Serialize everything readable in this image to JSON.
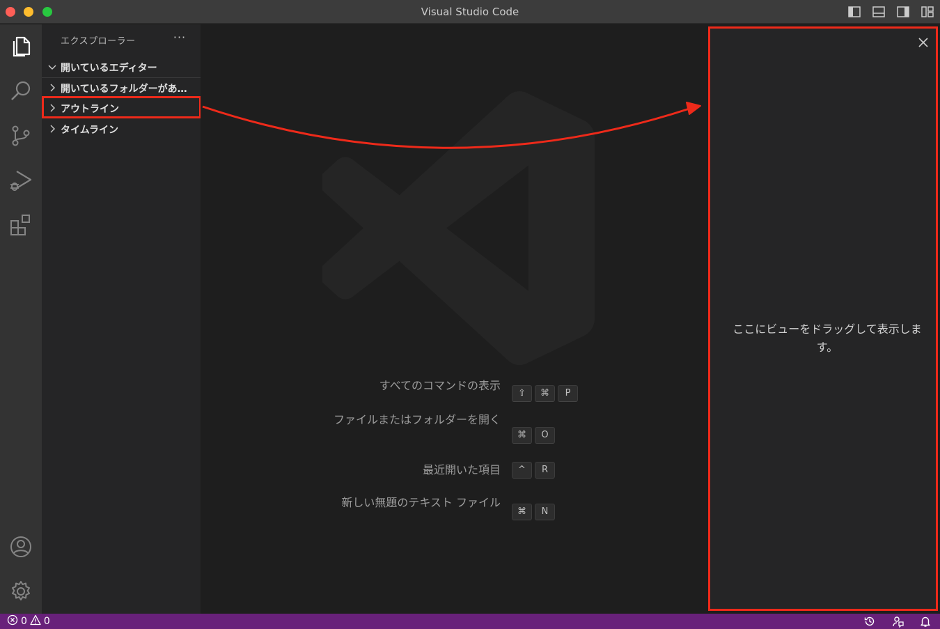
{
  "window": {
    "title": "Visual Studio Code"
  },
  "sidebar": {
    "header": "エクスプローラー",
    "more": "···",
    "sections": [
      {
        "label": "開いているエディター",
        "expanded": true
      },
      {
        "label": "開いているフォルダーがありません",
        "expanded": false
      },
      {
        "label": "アウトライン",
        "expanded": false,
        "highlighted": true
      },
      {
        "label": "タイムライン",
        "expanded": false
      }
    ]
  },
  "editor": {
    "shortcuts": [
      {
        "label": "すべてのコマンドの表示",
        "keys": [
          "⇧",
          "⌘",
          "P"
        ]
      },
      {
        "label": "ファイルまたはフォルダーを開く",
        "keys": [
          "⌘",
          "O"
        ]
      },
      {
        "label": "最近開いた項目",
        "keys": [
          "^",
          "R"
        ]
      },
      {
        "label": "新しい無題のテキスト ファイル",
        "keys": [
          "⌘",
          "N"
        ]
      }
    ]
  },
  "auxiliary_bar": {
    "message": "ここにビューをドラッグして表示します。",
    "highlight_color": "#ee2a1a"
  },
  "statusbar": {
    "errors": "0",
    "warnings": "0",
    "background": "#68217a"
  },
  "icons": {
    "activity": [
      "files-icon",
      "search-icon",
      "source-control-icon",
      "run-debug-icon",
      "extensions-icon",
      "account-icon",
      "settings-gear-icon"
    ],
    "titlebar": [
      "toggle-primary-sidebar-icon",
      "toggle-panel-icon",
      "toggle-secondary-sidebar-icon",
      "customize-layout-icon"
    ],
    "statusbar": [
      "history-icon",
      "feedback-icon",
      "bell-icon"
    ]
  }
}
